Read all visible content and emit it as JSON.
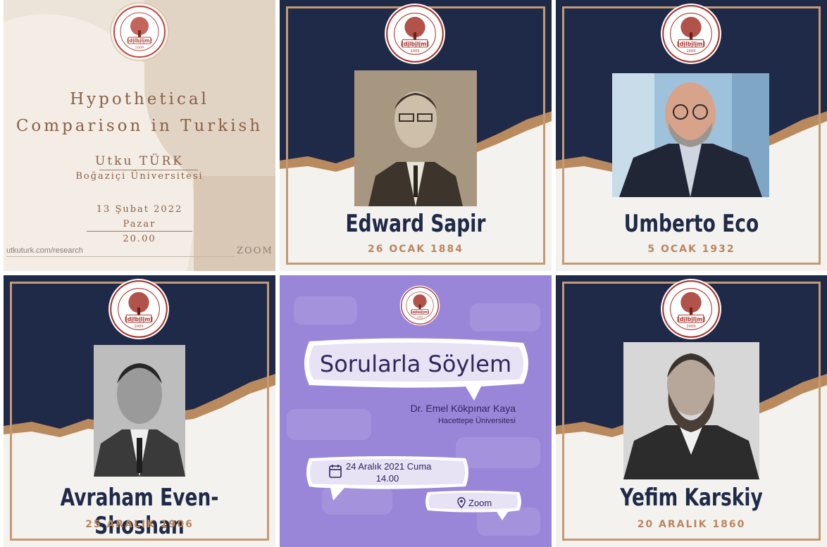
{
  "seal": {
    "top_text": "HACETTEPE ÜNİVERSİTESİ",
    "bottom_text": "DİLBİLİM TOPLULUĞU",
    "logo_text": "[dịlbịlịm]",
    "year": "2009"
  },
  "lecture": {
    "title_line1": "Hypothetical",
    "title_line2": "Comparison in Turkish",
    "speaker": "Utku TÜRK",
    "affiliation": "Boğaziçi Üniversitesi",
    "date": "13 Şubat 2022",
    "day": "Pazar",
    "time": "20.00",
    "url": "utkuturk.com/research",
    "platform": "ZOOM"
  },
  "portraits": [
    {
      "name": "Edward Sapir",
      "date": "26 OCAK 1884"
    },
    {
      "name": "Umberto Eco",
      "date": "5 OCAK 1932"
    },
    {
      "name": "Avraham Even-Shoshan",
      "date": "25 ARALIK 1906"
    },
    {
      "name": "Yefim Karskiy",
      "date": "20 ARALIK 1860"
    }
  ],
  "event": {
    "title": "Sorularla Söylem",
    "speaker": "Dr. Emel Kökpınar Kaya",
    "affiliation": "Hacettepe Üniversitesi",
    "date": "24 Aralık 2021 Cuma",
    "time": "14.00",
    "platform": "Zoom"
  },
  "colors": {
    "navy": "#1f2a48",
    "gold": "#c49a74",
    "purple": "#9a86d8",
    "seal_red": "#a5352c"
  }
}
